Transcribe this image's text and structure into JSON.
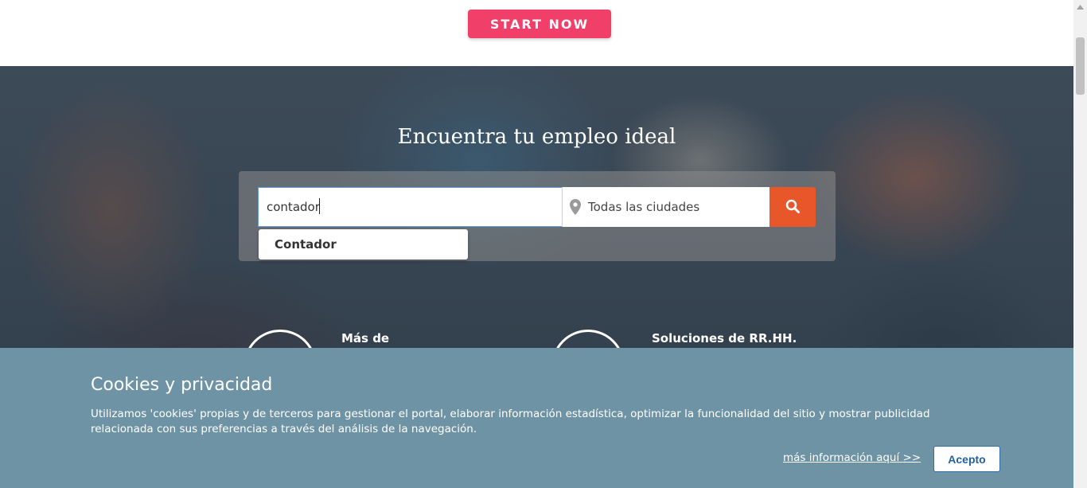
{
  "top": {
    "start_button": "START NOW"
  },
  "hero": {
    "title": "Encuentra tu empleo ideal",
    "search": {
      "keyword_value": "contador",
      "city_value": "Todas las ciudades"
    },
    "suggestions": [
      "Contador"
    ],
    "features": [
      {
        "label": "Más de"
      },
      {
        "label": "Soluciones de RR.HH."
      }
    ]
  },
  "cookie_banner": {
    "title": "Cookies y privacidad",
    "text": "Utilizamos 'cookies' propias y de terceros para gestionar el portal, elaborar información estadística, optimizar la funcionalidad del sitio y mostrar publicidad relacionada con sus preferencias a través del análisis de la navegación.",
    "more_link": "más información aquí >>",
    "accept_button": "Acepto"
  },
  "colors": {
    "start_button": "#f0406a",
    "search_button": "#e8572a",
    "cookie_banner": "#6e93a4",
    "accept_text": "#23609f"
  },
  "icons": {
    "city": "map-pin-icon",
    "search": "search-icon",
    "scroll_up": "chevron-up-icon"
  }
}
